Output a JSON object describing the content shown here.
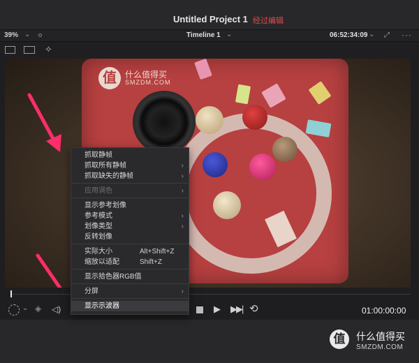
{
  "titlebar": {
    "project": "Untitled Project 1",
    "status": "经过编辑"
  },
  "viewer_bar": {
    "zoom": "39%",
    "timeline": "Timeline 1",
    "timecode": "06:52:34:09",
    "icons": [
      "chevron-down-icon",
      "expand-icon",
      "more-icon"
    ]
  },
  "viewer_image": {
    "mat_brand_cn": "什么值得买",
    "mat_brand_en": "SMZDM.COM",
    "mat_logo_char": "值"
  },
  "context_menu": {
    "items": [
      {
        "label": "抓取静帧",
        "submenu": false,
        "enabled": true
      },
      {
        "label": "抓取所有静帧",
        "submenu": true,
        "enabled": true
      },
      {
        "label": "抓取缺失的静帧",
        "submenu": true,
        "enabled": true
      },
      {
        "label": "应用调色",
        "submenu": true,
        "enabled": false
      },
      {
        "label": "显示参考划像",
        "submenu": false,
        "enabled": true
      },
      {
        "label": "参考模式",
        "submenu": true,
        "enabled": true
      },
      {
        "label": "划像类型",
        "submenu": true,
        "enabled": true
      },
      {
        "label": "反转划像",
        "submenu": false,
        "enabled": true
      },
      {
        "label": "实际大小",
        "shortcut": "Alt+Shift+Z",
        "enabled": true
      },
      {
        "label": "缩放以适配",
        "shortcut": "Shift+Z",
        "enabled": true
      },
      {
        "label": "显示拾色器RGB值",
        "submenu": false,
        "enabled": true
      },
      {
        "label": "分屏",
        "submenu": true,
        "enabled": true
      },
      {
        "label": "显示示波器",
        "submenu": false,
        "enabled": true,
        "highlighted": true
      }
    ],
    "submenu_glyph": "›"
  },
  "transport": {
    "timecode": "01:00:00:00"
  },
  "watermark": {
    "logo_char": "值",
    "cn": "什么值得买",
    "en": "SMZDM.COM"
  },
  "colors": {
    "accent_red": "#e24b4b",
    "arrow_pink": "#ff2d6b",
    "menu_bg": "#2a2a2d"
  }
}
